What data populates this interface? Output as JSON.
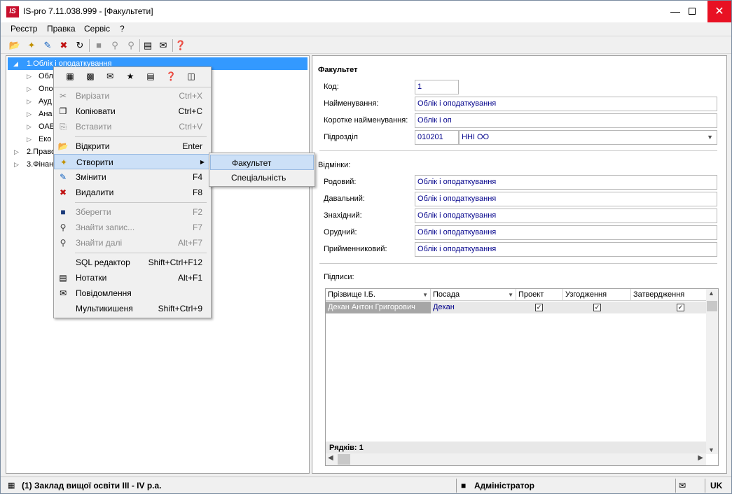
{
  "window": {
    "title": "IS-pro 7.11.038.999 - [Факультети]",
    "logo": "IS"
  },
  "menubar": [
    "Реєстр",
    "Правка",
    "Сервіс",
    "?"
  ],
  "tree": {
    "items": [
      {
        "label": "1.Облік і оподаткування",
        "expanded": true,
        "selected": true
      },
      {
        "label": "Обл",
        "level": 1
      },
      {
        "label": "Опо",
        "level": 1
      },
      {
        "label": "Ауд",
        "level": 1
      },
      {
        "label": "Ана",
        "level": 1
      },
      {
        "label": "ОАЕ",
        "level": 1
      },
      {
        "label": "Еко",
        "level": 1
      },
      {
        "label": "2.Право",
        "level": 0
      },
      {
        "label": "3.Фінан",
        "level": 0
      }
    ]
  },
  "context_menu": {
    "items": [
      {
        "label": "Вирізати",
        "shortcut": "Ctrl+X",
        "disabled": true,
        "icon": "scissors-icon"
      },
      {
        "label": "Копіювати",
        "shortcut": "Ctrl+C",
        "disabled": false,
        "icon": "copy-icon"
      },
      {
        "label": "Вставити",
        "shortcut": "Ctrl+V",
        "disabled": true,
        "icon": "paste-icon"
      },
      {
        "label": "Відкрити",
        "shortcut": "Enter",
        "disabled": false,
        "icon": "open-folder-icon"
      },
      {
        "label": "Створити",
        "shortcut": "",
        "disabled": false,
        "icon": "new-document-icon",
        "submenu": true
      },
      {
        "label": "Змінити",
        "shortcut": "F4",
        "disabled": false,
        "icon": "edit-document-icon"
      },
      {
        "label": "Видалити",
        "shortcut": "F8",
        "disabled": false,
        "icon": "delete-document-icon"
      },
      {
        "label": "Зберегти",
        "shortcut": "F2",
        "disabled": true,
        "icon": "save-icon"
      },
      {
        "label": "Знайти запис...",
        "shortcut": "F7",
        "disabled": true,
        "icon": "find-icon"
      },
      {
        "label": "Знайти далі",
        "shortcut": "Alt+F7",
        "disabled": true,
        "icon": "find-next-icon"
      },
      {
        "label": "SQL редактор",
        "shortcut": "Shift+Ctrl+F12",
        "disabled": false,
        "icon": ""
      },
      {
        "label": "Нотатки",
        "shortcut": "Alt+F1",
        "disabled": false,
        "icon": "notes-icon"
      },
      {
        "label": "Повідомлення",
        "shortcut": "",
        "disabled": false,
        "icon": "envelope-icon"
      },
      {
        "label": "Мультикишеня",
        "shortcut": "Shift+Ctrl+9",
        "disabled": false,
        "icon": ""
      }
    ]
  },
  "submenu": {
    "items": [
      "Факультет",
      "Спеціальність"
    ]
  },
  "form": {
    "section_title": "Факультет",
    "code_label": "Код:",
    "code_value": "1",
    "name_label": "Найменування:",
    "name_value": "Облік і оподаткування",
    "short_label": "Коротке найменування:",
    "short_value": "Облік і оп",
    "division_label": "Підрозділ",
    "division_code": "010201",
    "division_name": "ННІ ОО",
    "cases_title": "Відмінки:",
    "cases": [
      {
        "label": "Родовий:",
        "value": "Облік і оподаткування"
      },
      {
        "label": "Давальний:",
        "value": "Облік і оподаткування"
      },
      {
        "label": "Знахідний:",
        "value": "Облік і оподаткування"
      },
      {
        "label": "Орудний:",
        "value": "Облік і оподаткування"
      },
      {
        "label": "Прийменниковий:",
        "value": "Облік і оподаткування"
      }
    ],
    "signatures_title": "Підписи:",
    "grid": {
      "headers": [
        "Прізвище І.Б.",
        "Посада",
        "Проект",
        "Узгодження",
        "Затвердження"
      ],
      "rows": [
        {
          "name": "Декан Антон Григорович",
          "position": "Декан",
          "project": true,
          "approval": true,
          "confirm": true
        }
      ],
      "footer": "Рядків: 1"
    }
  },
  "statusbar": {
    "org": "(1) Заклад вищої освіти ІІІ - IV р.а.",
    "user": "Адміністратор",
    "lang": "UK"
  }
}
